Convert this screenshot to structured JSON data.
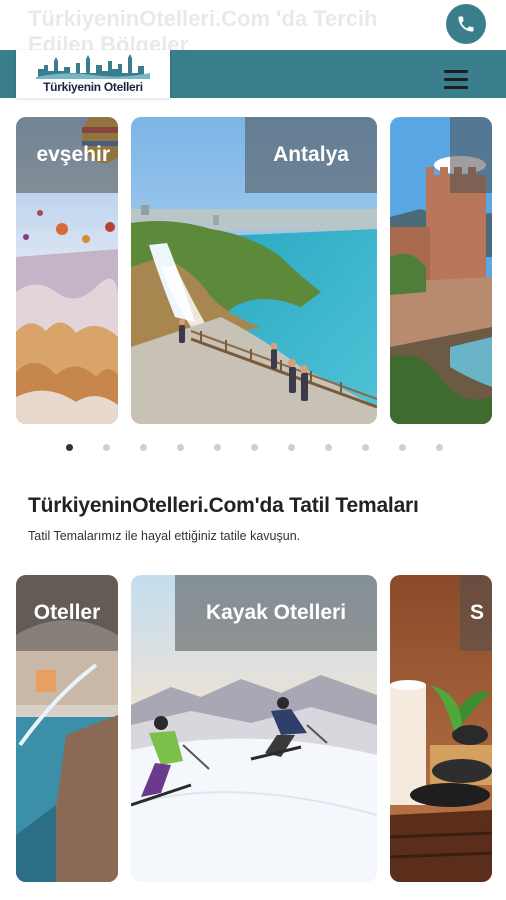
{
  "header": {
    "ghost_title": "TürkiyeninOtelleri.Com 'da Tercih Edilen Bölgeler",
    "logo_text": "Türkiyenin Otelleri",
    "brand_color": "#3a7d8c",
    "phone_icon": "phone-icon",
    "menu_icon": "hamburger-menu-icon"
  },
  "regions": {
    "slides": [
      {
        "label": "evşehir"
      },
      {
        "label": "Antalya"
      },
      {
        "label": ""
      }
    ],
    "dot_count": 11,
    "active_dot": 0
  },
  "themes": {
    "title": "TürkiyeninOtelleri.Com'da Tatil Temaları",
    "subtitle": "Tatil Temalarımız ile hayal ettiğiniz tatile kavuşun.",
    "slides": [
      {
        "label": "Oteller"
      },
      {
        "label": "Kayak Otelleri"
      },
      {
        "label": "S"
      }
    ]
  }
}
